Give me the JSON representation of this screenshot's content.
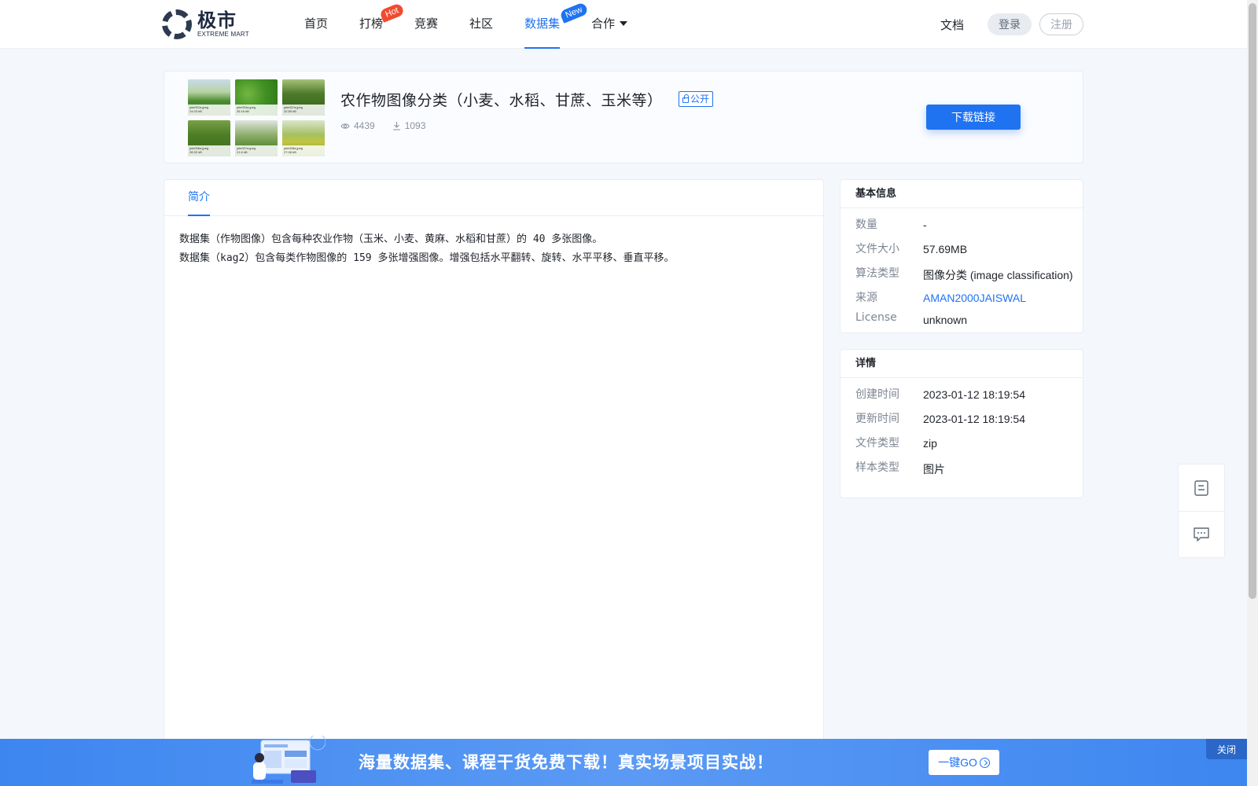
{
  "header": {
    "logo_cn": "极市",
    "logo_en": "EXTREME MART",
    "nav": [
      {
        "label": "首页"
      },
      {
        "label": "打榜",
        "badge": "Hot"
      },
      {
        "label": "竞赛"
      },
      {
        "label": "社区"
      },
      {
        "label": "数据集",
        "badge": "New",
        "active": true
      },
      {
        "label": "合作",
        "dropdown": true
      }
    ],
    "docs": "文档",
    "login": "登录",
    "register": "注册"
  },
  "dataset": {
    "title": "农作物图像分类（小麦、水稻、甘蔗、玉米等）",
    "visibility": "公开",
    "views": "4439",
    "downloads": "1093",
    "download_button": "下载链接",
    "thumbnails": [
      {
        "name": "jute001a.jpeg",
        "size": "24.03 kB"
      },
      {
        "name": "jute003a.jpeg",
        "size": "35.16 kB"
      },
      {
        "name": "jute007a.jpeg",
        "size": "32.89 kB"
      },
      {
        "name": "jute006a.jpeg",
        "size": "28.32 kB"
      },
      {
        "name": "jute007a.jpeg",
        "size": "21.6 kB"
      },
      {
        "name": "jute008a.jpeg",
        "size": "27.08 kB"
      }
    ]
  },
  "tabs": {
    "intro": "简介"
  },
  "description": {
    "line1": "数据集（作物图像）包含每种农业作物（玉米、小麦、黄麻、水稻和甘蔗）的 40 多张图像。",
    "line2": "数据集（kag2）包含每类作物图像的 159 多张增强图像。增强包括水平翻转、旋转、水平平移、垂直平移。"
  },
  "basic_info": {
    "title": "基本信息",
    "rows": [
      {
        "label": "数量",
        "value": "-"
      },
      {
        "label": "文件大小",
        "value": "57.69MB"
      },
      {
        "label": "算法类型",
        "value": "图像分类 (image classification)"
      },
      {
        "label": "来源",
        "value": "AMAN2000JAISWAL"
      },
      {
        "label": "License",
        "value": "unknown"
      }
    ]
  },
  "details": {
    "title": "详情",
    "rows": [
      {
        "label": "创建时间",
        "value": "2023-01-12 18:19:54"
      },
      {
        "label": "更新时间",
        "value": "2023-01-12 18:19:54"
      },
      {
        "label": "文件类型",
        "value": "zip"
      },
      {
        "label": "样本类型",
        "value": "图片"
      }
    ]
  },
  "floating_tools": [
    {
      "icon": "notes-icon"
    },
    {
      "icon": "feedback-icon"
    }
  ],
  "promo": {
    "text": "海量数据集、课程干货免费下载！真实场景项目实战！",
    "button": "一键GO",
    "close": "关闭"
  },
  "colors": {
    "accent": "#1f73f1",
    "hot_badge": "#f04b2f",
    "page_bg": "#f4f7fc",
    "promo_bg": "#4a90f2"
  }
}
